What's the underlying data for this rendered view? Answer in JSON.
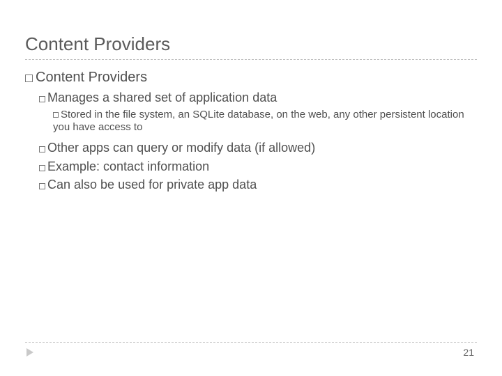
{
  "title": "Content Providers",
  "bullets": {
    "l1": "Content Providers",
    "l2a": "Manages a shared set of application data",
    "l3a": "Stored in the file system, an SQLite database, on the web, any other persistent location you have access to",
    "l2b": "Other apps can query or modify data (if allowed)",
    "l2c": "Example: contact information",
    "l2d": "Can also be used for private app data"
  },
  "page_number": "21"
}
